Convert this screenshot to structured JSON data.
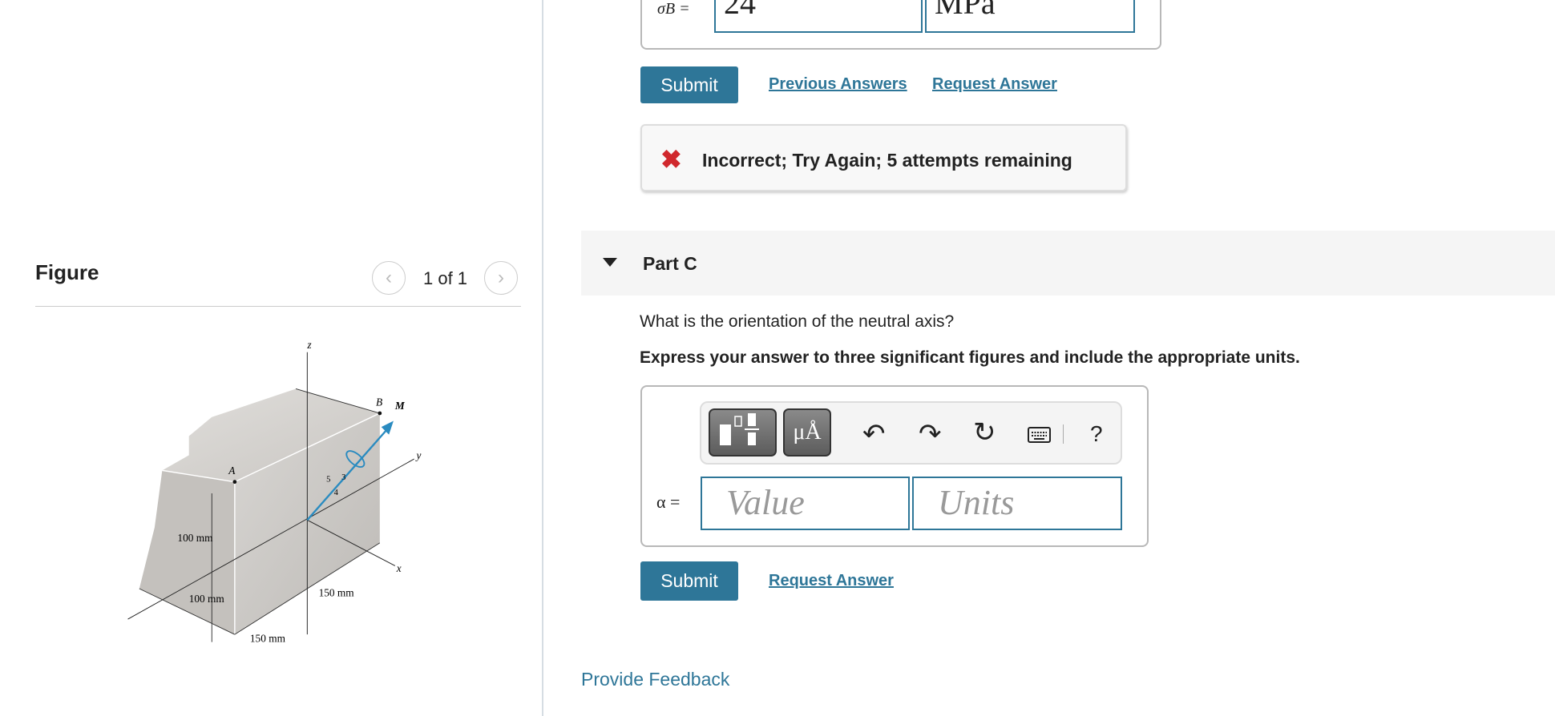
{
  "figure_panel": {
    "title": "Figure",
    "pager": "1 of 1",
    "prev_icon": "chevron-left-icon",
    "next_icon": "chevron-right-icon",
    "figure_labels": {
      "z": "z",
      "y": "y",
      "x": "x",
      "A": "A",
      "B": "B",
      "M": "M",
      "dim1": "100 mm",
      "dim2": "100 mm",
      "dim3": "150 mm",
      "dim4": "150 mm",
      "slope": [
        "5",
        "3",
        "4"
      ]
    }
  },
  "part_b": {
    "label": "σB =",
    "value": "24",
    "units": "MPa",
    "submit": "Submit",
    "previous_answers": "Previous Answers",
    "request_answer": "Request Answer",
    "feedback": "Incorrect; Try Again; 5 attempts remaining"
  },
  "part_c": {
    "label": "Part C",
    "question": "What is the orientation of the neutral axis?",
    "instruction": "Express your answer to three significant figures and include the appropriate units.",
    "toolbar": {
      "units_button": "μÅ",
      "help": "?"
    },
    "var_label": "α =",
    "value_placeholder": "Value",
    "units_placeholder": "Units",
    "submit": "Submit",
    "request_answer": "Request Answer"
  },
  "provide_feedback": "Provide Feedback",
  "colors": {
    "accent": "#2e7698",
    "error": "#d0282d"
  }
}
